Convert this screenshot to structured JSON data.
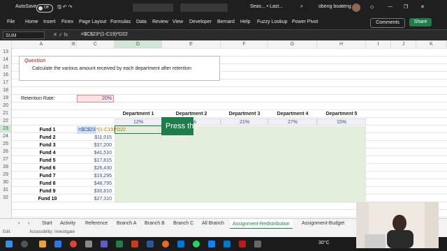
{
  "titlebar": {
    "autosave": "AutoSave",
    "autosave_state": "Off",
    "doc_title": "Seas... • Last...",
    "user": "obeng boateng"
  },
  "menu": [
    "File",
    "Home",
    "Insert",
    "Finex",
    "Page Layout",
    "Formulas",
    "Data",
    "Review",
    "View",
    "Developer",
    "Bernard",
    "Help",
    "Fuzzy Lookup",
    "Power Pivot"
  ],
  "buttons": {
    "comments": "Comments",
    "share": "Share"
  },
  "formula_bar": {
    "namebox": "SUM",
    "formula": "=$C$23*(1-C19)*D22"
  },
  "columns": [
    "A",
    "B",
    "C",
    "D",
    "E",
    "F",
    "G",
    "H",
    "I",
    "J",
    "K"
  ],
  "rows": [
    "13",
    "14",
    "15",
    "16",
    "17",
    "18",
    "19",
    "20",
    "21",
    "22",
    "23",
    "24",
    "25",
    "26",
    "27",
    "28",
    "29",
    "30",
    "31",
    "32"
  ],
  "sheet": {
    "question_label": "Question",
    "question_text": "Calculate the various amount received by each department after retention",
    "retention_label": "Retention Rate:",
    "retention_value": "20%",
    "departments": [
      {
        "name": "Department 1",
        "pct": "12%"
      },
      {
        "name": "Department 2",
        "pct": "%"
      },
      {
        "name": "Department 3",
        "pct": "21%"
      },
      {
        "name": "Department 4",
        "pct": "27%"
      },
      {
        "name": "Department 5",
        "pct": "15%"
      }
    ],
    "funds": [
      {
        "name": "Fund 1",
        "amount": "=$C$23"
      },
      {
        "name": "Fund 2",
        "amount": "$11,015"
      },
      {
        "name": "Fund 3",
        "amount": "$37,200"
      },
      {
        "name": "Fund 4",
        "amount": "$41,510"
      },
      {
        "name": "Fund 5",
        "amount": "$17,815"
      },
      {
        "name": "Fund 6",
        "amount": "$26,430"
      },
      {
        "name": "Fund 7",
        "amount": "$16,295"
      },
      {
        "name": "Fund 8",
        "amount": "$48,795"
      },
      {
        "name": "Fund 9",
        "amount": "$30,810"
      },
      {
        "name": "Fund 10",
        "amount": "$27,310"
      }
    ],
    "edit_formula_rest": "*(1-C19)*D22",
    "tooltip": "Press th"
  },
  "tabs": [
    "Start",
    "Activity",
    "Reference",
    "Branch A",
    "Branch B",
    "Branch C",
    "All Branch",
    "Assignment-Redistribution",
    "Assignment-Budget"
  ],
  "active_tab": "Assignment-Redistribution",
  "status": {
    "mode": "Edit",
    "accessibility": "Accessibility: Investigate"
  },
  "taskbar": {
    "temp": "30°C"
  },
  "colors": {
    "excel_green": "#1e7d4a",
    "fill_green": "#e3efda"
  }
}
